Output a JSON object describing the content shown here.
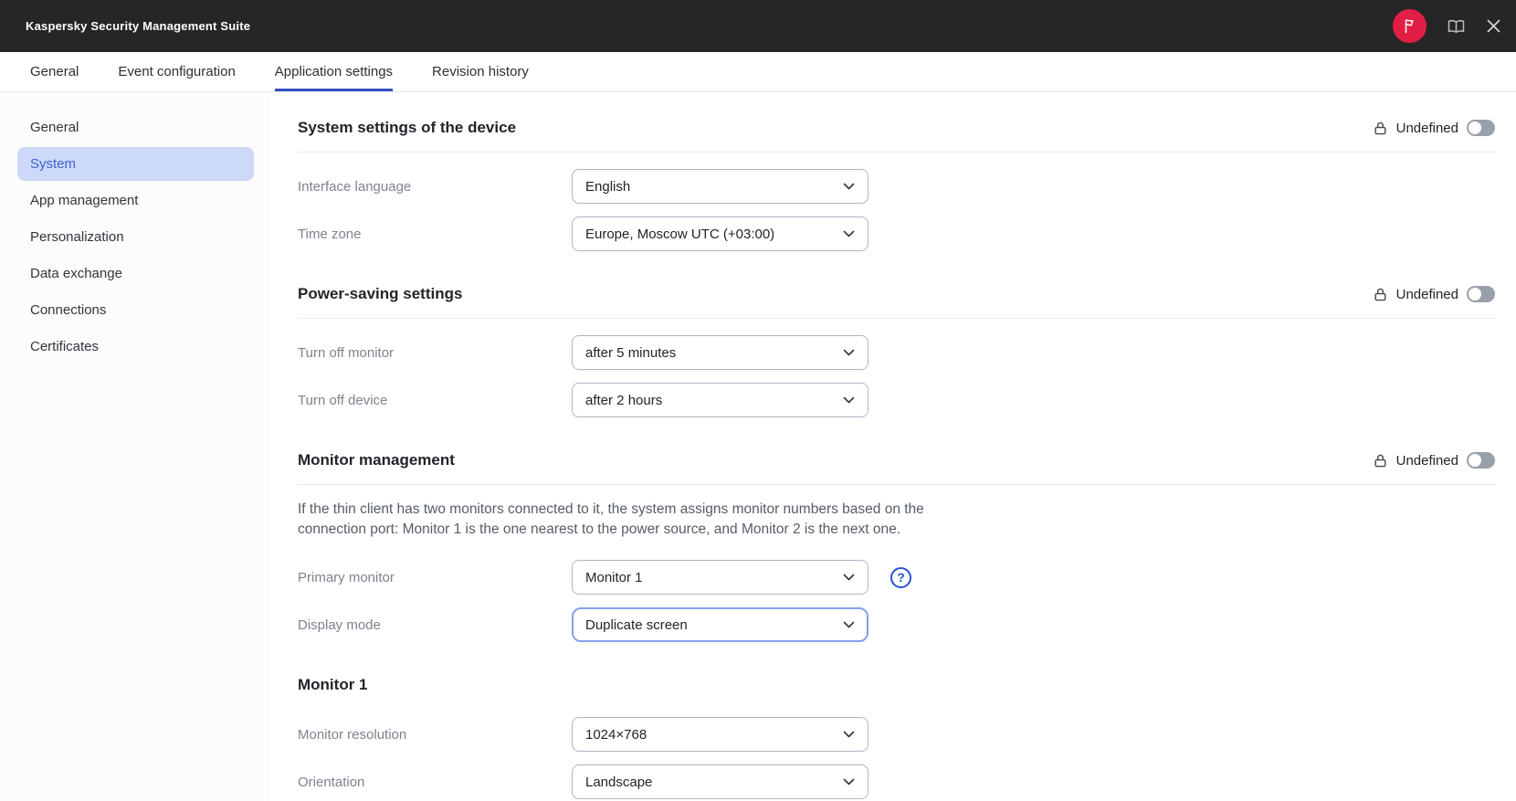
{
  "topbar": {
    "title": "Kaspersky Security Management Suite",
    "icons": [
      "flag-icon",
      "book-icon",
      "close-icon"
    ],
    "colors": {
      "background": "#262626",
      "flag_badge": "#e31e45"
    }
  },
  "tabs": [
    {
      "label": "General",
      "active": false
    },
    {
      "label": "Event configuration",
      "active": false
    },
    {
      "label": "Application settings",
      "active": true
    },
    {
      "label": "Revision history",
      "active": false
    }
  ],
  "sidebar": {
    "items": [
      {
        "label": "General",
        "selected": false
      },
      {
        "label": "System",
        "selected": true
      },
      {
        "label": "App management",
        "selected": false
      },
      {
        "label": "Personalization",
        "selected": false
      },
      {
        "label": "Data exchange",
        "selected": false
      },
      {
        "label": "Connections",
        "selected": false
      },
      {
        "label": "Certificates",
        "selected": false
      }
    ]
  },
  "sections": [
    {
      "title": "System settings of the device",
      "override": {
        "label": "Undefined",
        "on": false,
        "lock_icon": "unlock-icon"
      },
      "fields": [
        {
          "label": "Interface language",
          "value": "English"
        },
        {
          "label": "Time zone",
          "value": "Europe, Moscow UTC (+03:00)"
        }
      ]
    },
    {
      "title": "Power-saving settings",
      "override": {
        "label": "Undefined",
        "on": false,
        "lock_icon": "unlock-icon"
      },
      "fields": [
        {
          "label": "Turn off monitor",
          "value": "after 5 minutes"
        },
        {
          "label": "Turn off device",
          "value": "after 2 hours"
        }
      ]
    },
    {
      "title": "Monitor management",
      "override": {
        "label": "Undefined",
        "on": false,
        "lock_icon": "unlock-icon"
      },
      "description": "If the thin client has two monitors connected to it, the system assigns monitor numbers based on the connection port: Monitor 1 is the one nearest to the power source, and Monitor 2 is the next one.",
      "fields": [
        {
          "label": "Primary monitor",
          "value": "Monitor 1",
          "help_icon": "help-icon"
        },
        {
          "label": "Display mode",
          "value": "Duplicate screen",
          "focused": true
        }
      ]
    },
    {
      "title": "Monitor 1",
      "fields": [
        {
          "label": "Monitor resolution",
          "value": "1024×768"
        },
        {
          "label": "Orientation",
          "value": "Landscape"
        }
      ]
    }
  ],
  "colors": {
    "active_tab_underline": "#3550c4",
    "selected_item_bg": "#cdd9f8",
    "selected_item_text": "#3e5fd5",
    "focus_border": "#84a0ef",
    "help_icon": "#2b52d6",
    "label_gray": "#7e828e",
    "divider": "#e9eaef"
  }
}
